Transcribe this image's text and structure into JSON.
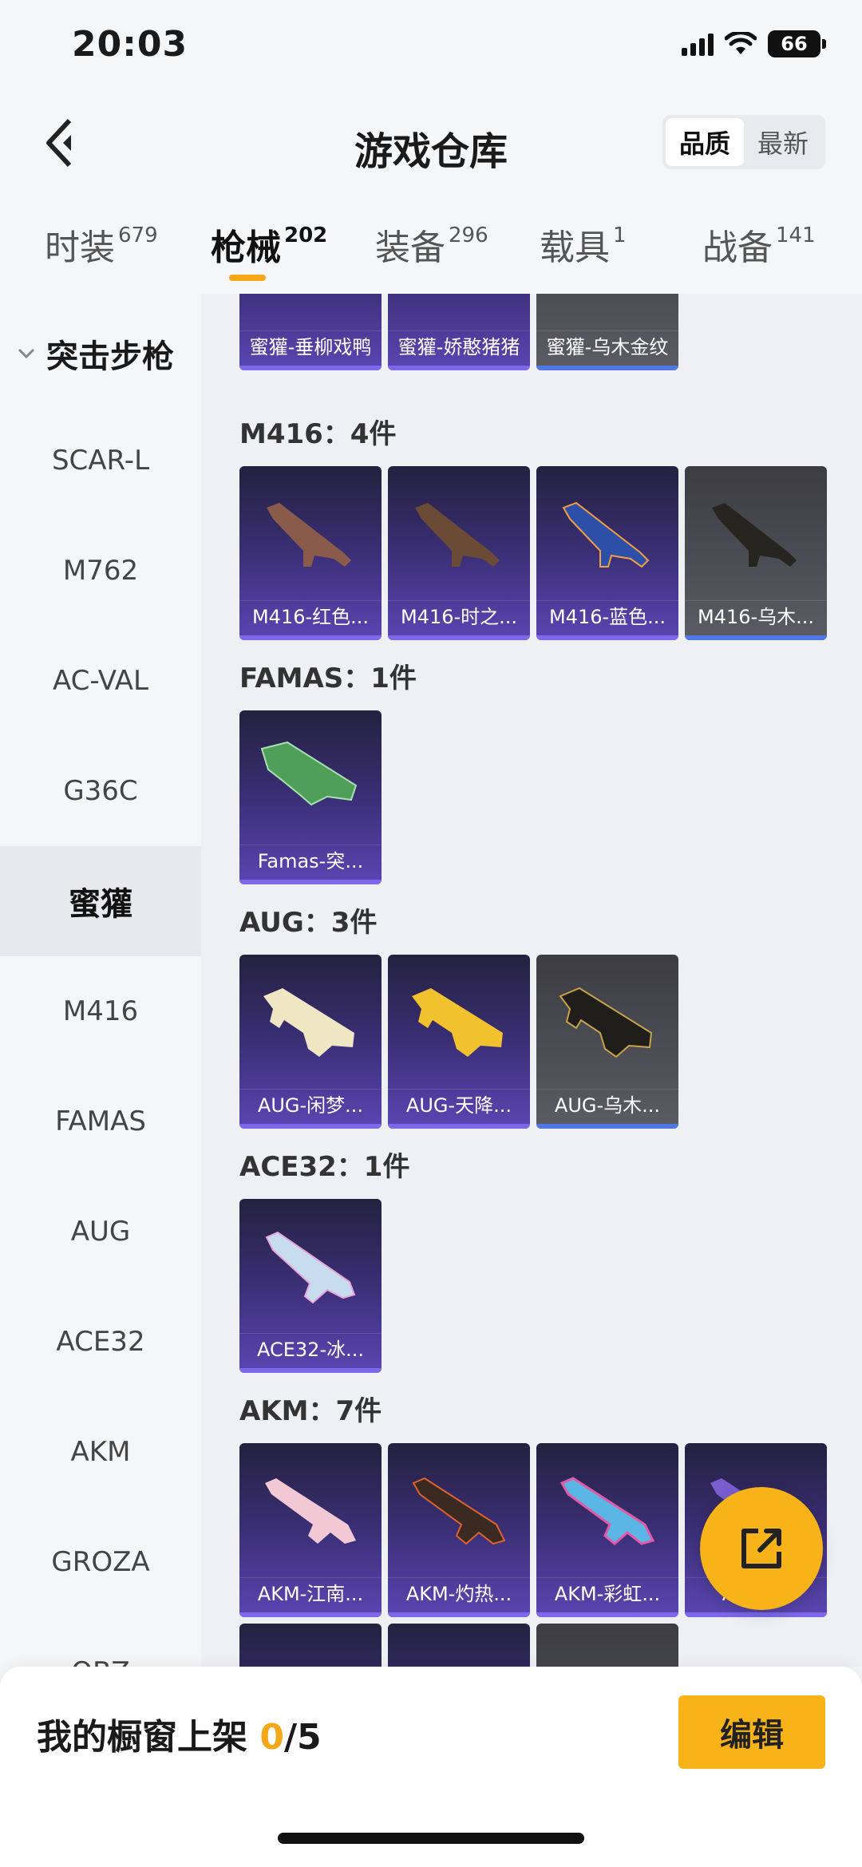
{
  "status": {
    "time": "20:03",
    "battery": "66"
  },
  "header": {
    "title": "游戏仓库",
    "sort_quality": "品质",
    "sort_newest": "最新"
  },
  "tabs": [
    {
      "label": "时装",
      "count": "679"
    },
    {
      "label": "枪械",
      "count": "202"
    },
    {
      "label": "装备",
      "count": "296"
    },
    {
      "label": "载具",
      "count": "1"
    },
    {
      "label": "战备",
      "count": "141"
    }
  ],
  "sidebar": {
    "group": "突击步枪",
    "items": [
      "SCAR-L",
      "M762",
      "AC-VAL",
      "G36C",
      "蜜獾",
      "M416",
      "FAMAS",
      "AUG",
      "ACE32",
      "AKM",
      "GROZA",
      "QBZ"
    ]
  },
  "main": {
    "top_cards": [
      "蜜獾-垂柳戏鸭",
      "蜜獾-娇憨猪猪",
      "蜜獾-乌木金纹"
    ],
    "groups": [
      {
        "label": "M416：4件",
        "cards": [
          "M416-红色...",
          "M416-时之...",
          "M416-蓝色...",
          "M416-乌木..."
        ]
      },
      {
        "label": "FAMAS：1件",
        "cards": [
          "Famas-突..."
        ]
      },
      {
        "label": "AUG：3件",
        "cards": [
          "AUG-闲梦...",
          "AUG-天降...",
          "AUG-乌木..."
        ]
      },
      {
        "label": "ACE32：1件",
        "cards": [
          "ACE32-冰..."
        ]
      },
      {
        "label": "AKM：7件",
        "cards": [
          "AKM-江南...",
          "AKM-灼热...",
          "AKM-彩虹...",
          "AKM-..."
        ]
      }
    ]
  },
  "bottom": {
    "showcase_label": "我的橱窗上架 ",
    "showcase_count": "0",
    "showcase_total": "/5",
    "edit_label": "编辑"
  },
  "colors": {
    "accent": "#f8b319",
    "card_purple": "#5a46b3",
    "card_grey": "#4e4e56"
  }
}
